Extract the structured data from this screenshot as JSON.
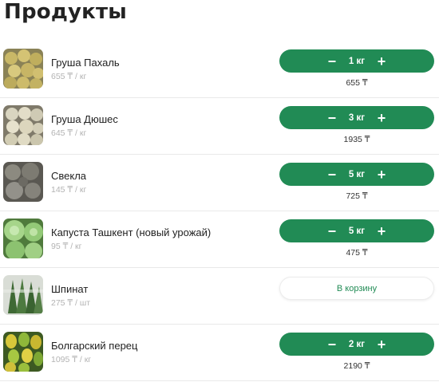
{
  "page": {
    "title": "Продукты"
  },
  "colors": {
    "accent": "#218b55",
    "muted_text": "#b3b3b3"
  },
  "products": [
    {
      "name": "Груша Пахаль",
      "unit_price": "655 ₸ / кг",
      "quantity": "1 кг",
      "total": "655 ₸",
      "in_cart": true,
      "image": "pears-yellow-image"
    },
    {
      "name": "Груша Дюшес",
      "unit_price": "645 ₸ / кг",
      "quantity": "3 кг",
      "total": "1935 ₸",
      "in_cart": true,
      "image": "pears-pale-image"
    },
    {
      "name": "Свекла",
      "unit_price": "145 ₸ / кг",
      "quantity": "5 кг",
      "total": "725 ₸",
      "in_cart": true,
      "image": "beets-image"
    },
    {
      "name": "Капуста Ташкент (новый урожай)",
      "unit_price": "95 ₸ / кг",
      "quantity": "5 кг",
      "total": "475 ₸",
      "in_cart": true,
      "image": "cabbage-image"
    },
    {
      "name": "Шпинат",
      "unit_price": "275 ₸ / шт",
      "cart_label": "В корзину",
      "in_cart": false,
      "image": "spinach-image"
    },
    {
      "name": "Болгарский перец",
      "unit_price": "1095 ₸ / кг",
      "quantity": "2 кг",
      "total": "2190 ₸",
      "in_cart": true,
      "image": "peppers-image"
    }
  ],
  "controls": {
    "minus": "−",
    "plus": "+"
  }
}
